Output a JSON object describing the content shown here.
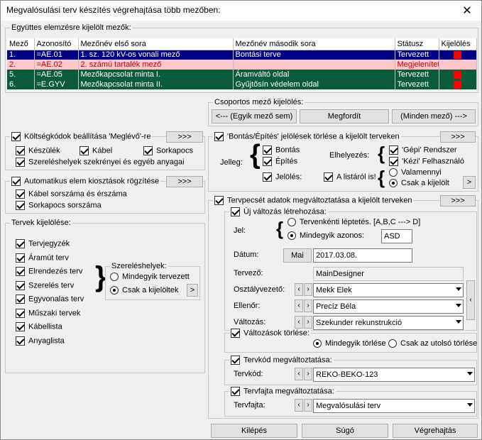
{
  "window": {
    "title": "Megvalósulási terv készítés végrehajtása több mezőben:"
  },
  "fields_group": {
    "label": "Együttes elemzésre kijelölt mezők:",
    "headers": [
      "Mező",
      "Azonosító",
      "Mezőnév első sora",
      "Mezőnév második sora",
      "Státusz",
      "Kijelölés"
    ],
    "rows": [
      {
        "n": "1.",
        "id": "=AE.01",
        "name1": "1. sz. 120 kV-os vonali mező",
        "name2": "Bontási terve",
        "status": "Tervezett",
        "selected": true,
        "style": "blue"
      },
      {
        "n": "2.",
        "id": "=AE.02",
        "name1": "2. számú tartalék mező",
        "name2": "",
        "status": "Megjelenített",
        "selected": false,
        "style": "pink"
      },
      {
        "n": "5.",
        "id": "=AE.05",
        "name1": "Mezőkapcsolat minta I.",
        "name2": "Áramváltó oldal",
        "status": "Tervezett",
        "selected": true,
        "style": "green"
      },
      {
        "n": "6.",
        "id": "=E.GYV",
        "name1": "Mezőkapcsolat minta II.",
        "name2": "Gyűjtősín védelem oldal",
        "status": "Tervezett",
        "selected": true,
        "style": "green"
      }
    ]
  },
  "group_select": {
    "label": "Csoportos mező kijelölés:",
    "btn_none": "<--- (Egyik mező sem)",
    "btn_invert": "Megfordít",
    "btn_all": "(Minden mező) --->"
  },
  "cost": {
    "label": "Költségkódok beállítása 'Meglévő'-re",
    "more": ">>>",
    "keszulek": "Készülék",
    "kabel": "Kábel",
    "sorkapocs": "Sorkapocs",
    "szerelohelyek": "Szereléshelyek szekrényei és egyéb anyagai"
  },
  "auto": {
    "label": "Automatikus elem kiosztások rögzítése",
    "more": ">>>",
    "kabel": "Kábel sorszáma és érszáma",
    "sorkapocs": "Sorkapocs sorszáma"
  },
  "plans": {
    "label": "Tervek kijelölése:",
    "items": [
      "Tervjegyzék",
      "Áramút terv",
      "Elrendezés terv",
      "Szerelés terv",
      "Egyvonalas terv",
      "Műszaki tervek",
      "Kábellista",
      "Anyaglista"
    ],
    "install_label": "Szereléshelyek:",
    "install_all": "Mindegyik tervezett",
    "install_selected": "Csak a kijelöltek",
    "nav": ">"
  },
  "bontas": {
    "label": "'Bontás/Építés' jelölések törlése a kijelölt terveken",
    "more": ">>>",
    "jelleg": "Jelleg:",
    "bontas": "Bontás",
    "epites": "Építés",
    "jeloles": "Jelölés:",
    "listarol": "A listáról is!",
    "elhelyezes": "Elhelyezés:",
    "gepi": "'Gépi' Rendszer",
    "kezi": "'Kézi' Felhasználó",
    "valamennyi": "Valamennyi",
    "csak": "Csak a kijelölt",
    "nav": ">"
  },
  "stamp": {
    "label": "Tervpecsét adatok megváltoztatása a kijelölt terveken",
    "more": ">>>",
    "new_change": "Új változás létrehozása:",
    "jel": "Jel:",
    "jel_step": "Tervenkénti léptetés. [A,B,C ---> D]",
    "jel_all": "Mindegyik azonos:",
    "jel_value": "ASD",
    "datum": "Dátum:",
    "mai": "Mai",
    "datum_value": "2017.03.08.",
    "tervezo": "Tervező:",
    "tervezo_value": "MainDesigner",
    "osztaly": "Osztályvezető:",
    "osztaly_value": "Mekk Elek",
    "ellenor": "Ellenőr:",
    "ellenor_value": "Precíz Béla",
    "valtozas": "Változás:",
    "valtozas_value": "Szekunder rekunstrukció",
    "del_changes": "Változások törlése:",
    "del_all": "Mindegyik törlése",
    "del_last": "Csak az utolsó törlése",
    "code_change": "Tervkód megváltoztatása:",
    "code": "Tervkód:",
    "code_value": "REKO-BEKO-123",
    "type_change": "Tervfajta megváltoztatása:",
    "type": "Tervfajta:",
    "type_value": "Megvalósulási terv"
  },
  "footer": {
    "exit": "Kilépés",
    "help": "Súgó",
    "run": "Végrehajtás"
  }
}
